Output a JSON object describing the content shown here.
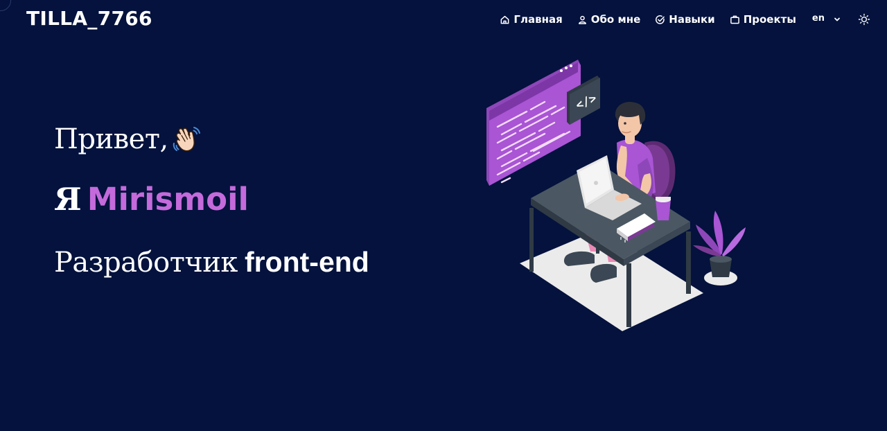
{
  "brand": {
    "logo_text": "TILLA_7766"
  },
  "nav": {
    "items": [
      {
        "label": "Главная",
        "icon": "home-icon"
      },
      {
        "label": "Обо мне",
        "icon": "user-icon"
      },
      {
        "label": "Навыки",
        "icon": "check-circle-icon"
      },
      {
        "label": "Проекты",
        "icon": "briefcase-icon"
      }
    ],
    "language": {
      "value": "en",
      "icon": "chevron-down-icon"
    },
    "theme_toggle": {
      "icon": "sun-icon"
    }
  },
  "hero": {
    "greeting": "Привет,",
    "greeting_icon": "waving-hand-icon",
    "intro_prefix": "Я",
    "name": "Mirismoil",
    "role_text": "Разработчик",
    "role_highlight": "front-end"
  },
  "illustration": {
    "code_tag": "</>"
  },
  "colors": {
    "background": "#04123d",
    "accent": "#c46adb",
    "text": "#ffffff"
  }
}
